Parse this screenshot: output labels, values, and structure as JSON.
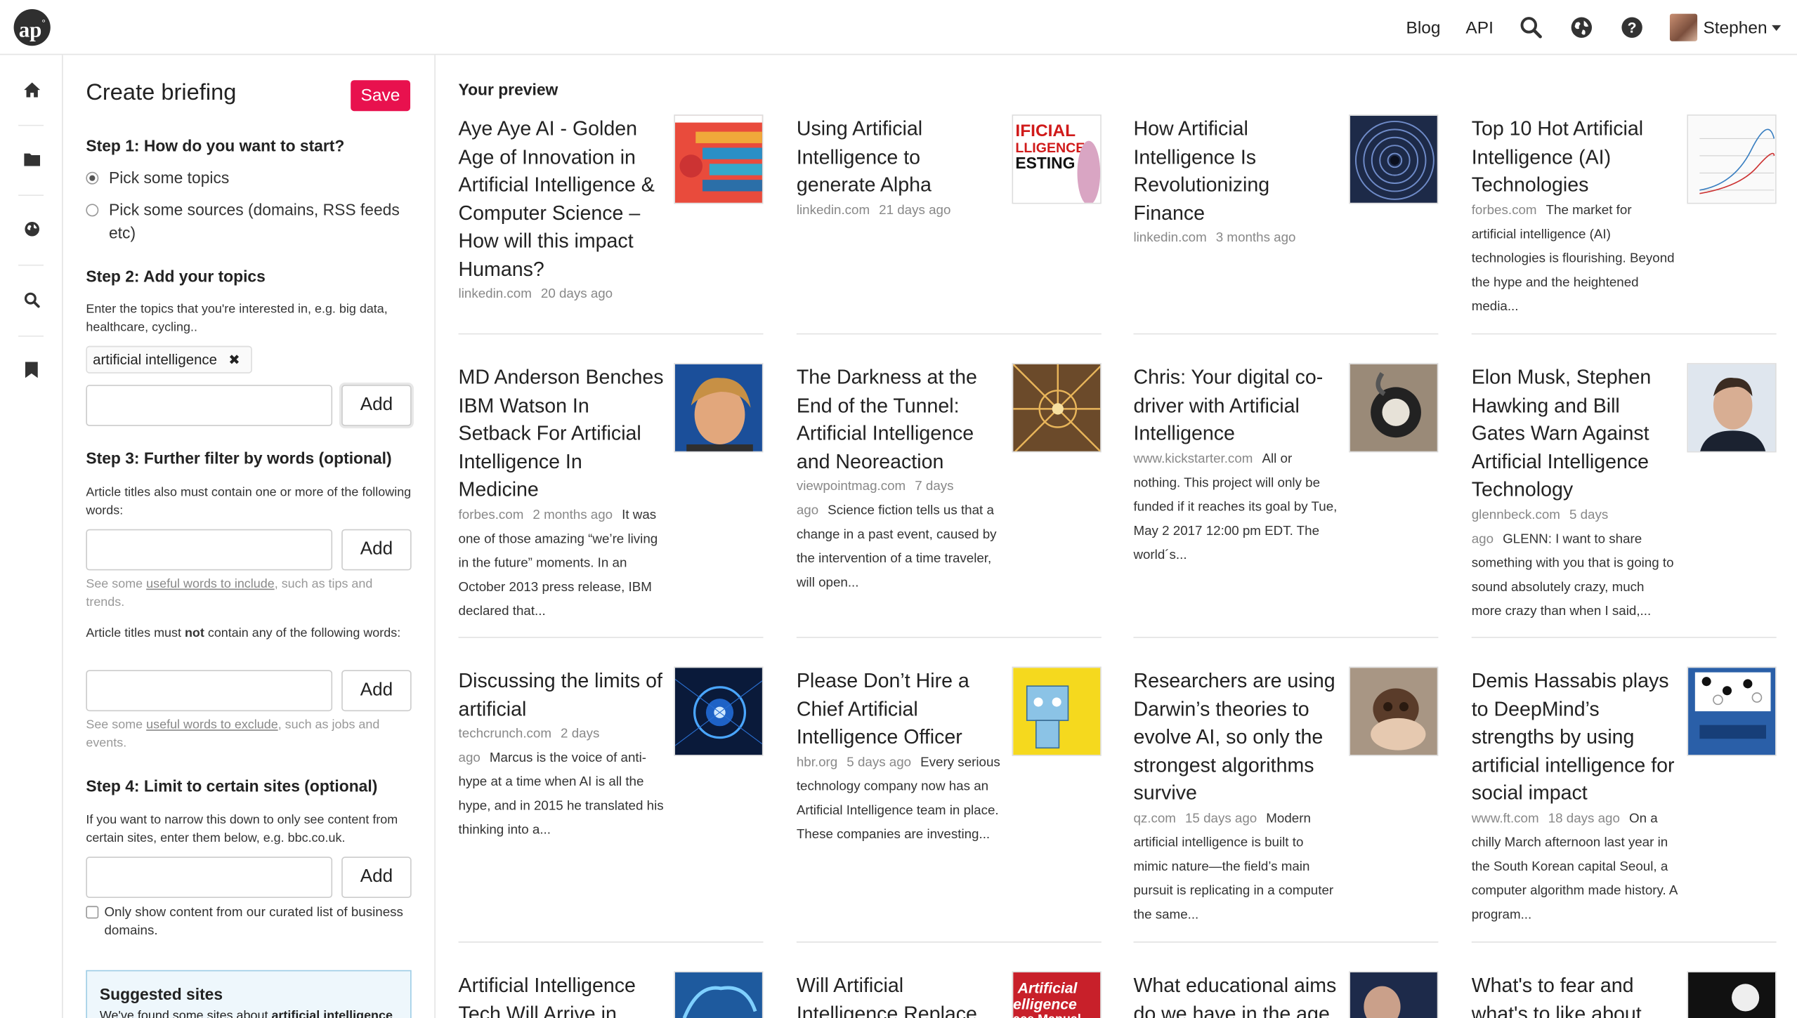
{
  "app": {
    "logo_text": "ap"
  },
  "topnav": {
    "blog": "Blog",
    "api": "API",
    "user_name": "Stephen"
  },
  "rail": [
    "home-icon",
    "folder-icon",
    "globe-icon",
    "search-icon",
    "bookmark-icon"
  ],
  "panel": {
    "title": "Create briefing",
    "save_label": "Save",
    "step1": "Step 1: How do you want to start?",
    "option_topics": "Pick some topics",
    "option_sources": "Pick some sources (domains, RSS feeds etc)",
    "step2": "Step 2: Add your topics",
    "step2_help": "Enter the topics that you're interested in, e.g. big data, healthcare, cycling..",
    "topic_chip": "artificial intelligence",
    "add_label": "Add",
    "step3": "Step 3: Further filter by words (optional)",
    "step3_help": "Article titles also must contain one or more of the following words:",
    "include_hint_pre": "See some ",
    "include_hint_link": "useful words to include",
    "include_hint_post": ", such as tips and trends.",
    "exclude_help_pre": "Article titles must ",
    "exclude_help_strong": "not",
    "exclude_help_post": " contain any of the following words:",
    "exclude_hint_pre": "See some ",
    "exclude_hint_link": "useful words to exclude",
    "exclude_hint_post": ", such as jobs and events.",
    "step4": "Step 4: Limit to certain sites (optional)",
    "step4_help": "If you want to narrow this down to only see content from certain sites, enter them below, e.g. bbc.co.uk.",
    "curated_label": "Only show content from our curated list of business domains.",
    "suggest_title": "Suggested sites",
    "suggest_text_pre": "We've found some sites about ",
    "suggest_text_strong": "artificial intelligence"
  },
  "preview": {
    "heading": "Your preview",
    "cards": [
      {
        "title": "Aye Aye AI - Golden Age of Innovation in Artificial Intelligence & Computer Science – How will this impact Humans?",
        "source": "linkedin.com",
        "age": "20 days ago",
        "excerpt": "",
        "thumb": "infographic"
      },
      {
        "title": "Using Artificial Intelligence to generate Alpha",
        "source": "linkedin.com",
        "age": "21 days ago",
        "excerpt": "",
        "thumb": "poster"
      },
      {
        "title": "How Artificial Intelligence Is Revolutionizing Finance",
        "source": "linkedin.com",
        "age": "3 months ago",
        "excerpt": "",
        "thumb": "spiral"
      },
      {
        "title": "Top 10 Hot Artificial Intelligence (AI) Technologies",
        "source": "forbes.com",
        "age": "",
        "excerpt": "The market for artificial intelligence (AI) technologies is flourishing. Beyond the hype and the heightened media...",
        "thumb": "chart"
      },
      {
        "title": "MD Anderson Benches IBM Watson In Setback For Artificial Intelligence In Medicine",
        "source": "forbes.com",
        "age": "2 months ago",
        "excerpt": "It was one of those amazing “we’re living in the future” moments. In an October 2013 press release, IBM declared that...",
        "thumb": "portrait-woman"
      },
      {
        "title": "The Darkness at the End of the Tunnel: Artificial Intelligence and Neoreaction",
        "source": "viewpointmag.com",
        "age": "7 days ago",
        "excerpt": "Science fiction tells us that a change in a past event, caused by the intervention of a time traveler, will open...",
        "thumb": "cathedral"
      },
      {
        "title": "Chris: Your digital co-driver with Artificial Intelligence",
        "source": "www.kickstarter.com",
        "age": "",
        "excerpt": "All or nothing. This project will only be funded if it reaches its goal by Tue, May 2 2017 12:00 pm EDT. The world´s...",
        "thumb": "device"
      },
      {
        "title": "Elon Musk, Stephen Hawking and Bill Gates Warn Against Artificial Intelligence Technology",
        "source": "glennbeck.com",
        "age": "5 days ago",
        "excerpt": "GLENN: I want to share something with you that is going to sound absolutely crazy, much more crazy than when I said,...",
        "thumb": "portrait-man"
      },
      {
        "title": "Discussing the limits of artificial",
        "source": "techcrunch.com",
        "age": "2 days ago",
        "excerpt": "Marcus is the voice of anti-hype at a time when AI is all the hype, and in 2015 he translated his thinking into a...",
        "thumb": "eye"
      },
      {
        "title": "Please Don’t Hire a Chief Artificial Intelligence Officer",
        "source": "hbr.org",
        "age": "5 days ago",
        "excerpt": "Every serious technology company now has an Artificial Intelligence team in place. These companies are investing...",
        "thumb": "robot"
      },
      {
        "title": "Researchers are using Darwin’s theories to evolve AI, so only the strongest algorithms survive",
        "source": "qz.com",
        "age": "15 days ago",
        "excerpt": "Modern artificial intelligence is built to mimic nature—the field’s main pursuit is replicating in a computer the same...",
        "thumb": "skull"
      },
      {
        "title": "Demis Hassabis plays to DeepMind’s strengths by using artificial intelligence for social impact",
        "source": "www.ft.com",
        "age": "18 days ago",
        "excerpt": "On a chilly March afternoon last year in the South Korean capital Seoul, a computer algorithm made history. A program...",
        "thumb": "go"
      },
      {
        "title": "Artificial Intelligence Tech Will Arrive in",
        "source": "",
        "age": "",
        "excerpt": "",
        "thumb": "brain"
      },
      {
        "title": "Will Artificial Intelligence Replace",
        "source": "",
        "age": "",
        "excerpt": "",
        "thumb": "book"
      },
      {
        "title": "What educational aims do we have in the age",
        "source": "",
        "age": "",
        "excerpt": "",
        "thumb": "child"
      },
      {
        "title": "What's to fear and what's to like about",
        "source": "",
        "age": "",
        "excerpt": "",
        "thumb": "dark"
      }
    ]
  }
}
